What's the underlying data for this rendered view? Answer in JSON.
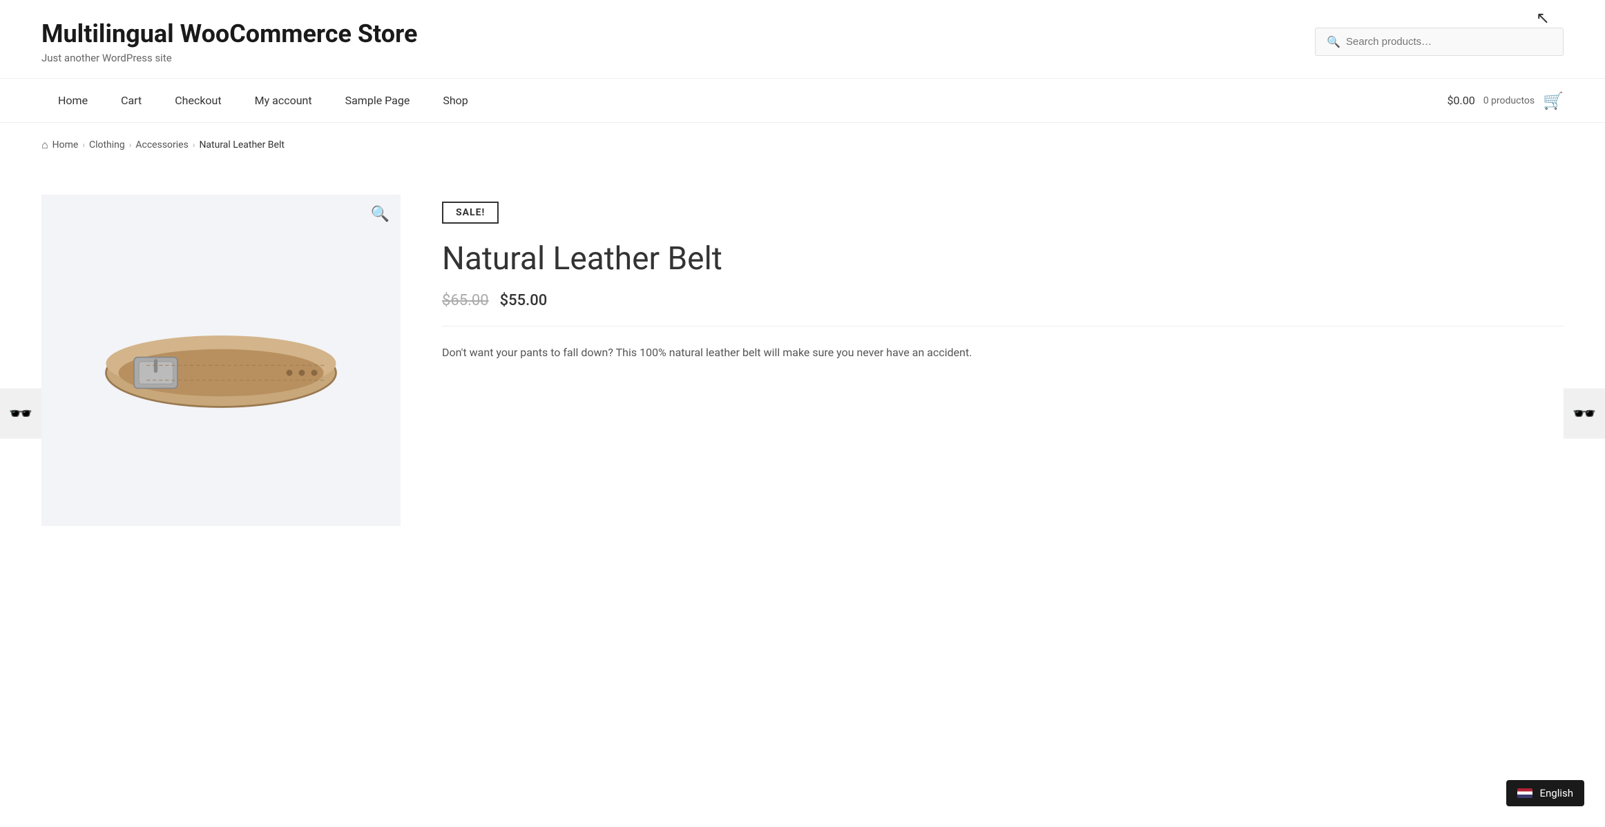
{
  "site": {
    "title": "Multilingual WooCommerce Store",
    "tagline": "Just another WordPress site"
  },
  "search": {
    "placeholder": "Search products…"
  },
  "nav": {
    "links": [
      {
        "label": "Home",
        "href": "#"
      },
      {
        "label": "Cart",
        "href": "#"
      },
      {
        "label": "Checkout",
        "href": "#"
      },
      {
        "label": "My account",
        "href": "#"
      },
      {
        "label": "Sample Page",
        "href": "#"
      },
      {
        "label": "Shop",
        "href": "#"
      }
    ],
    "cart_amount": "$0.00",
    "cart_count": "0 productos"
  },
  "breadcrumb": {
    "home_label": "Home",
    "crumbs": [
      {
        "label": "Clothing",
        "href": "#"
      },
      {
        "label": "Accessories",
        "href": "#"
      }
    ],
    "current": "Natural Leather Belt"
  },
  "product": {
    "sale_badge": "SALE!",
    "title": "Natural Leather Belt",
    "original_price": "$65.00",
    "sale_price": "$55.00",
    "description": "Don't want your pants to fall down? This 100% natural leather belt will make sure you never have an accident."
  },
  "language": {
    "label": "English"
  }
}
